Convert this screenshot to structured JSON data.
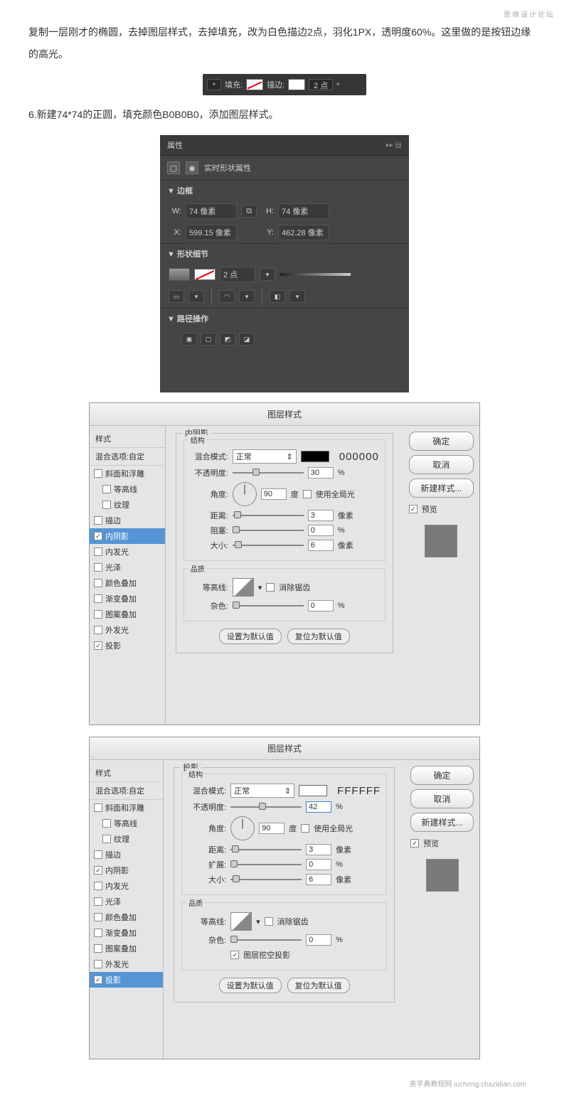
{
  "watermark": "思缘设计论坛",
  "paragraphs": {
    "p1": "复制一层刚才的椭圆，去掉图层样式，去掉填充，改为白色描边2点，羽化1PX，透明度60%。这里做的是按钮边缘的高光。",
    "p2": "6.新建74*74的正圆，填充颜色B0B0B0，添加图层样式。"
  },
  "toolbar": {
    "fill_label": "填充:",
    "stroke_label": "描边:",
    "stroke_value": "2 点"
  },
  "properties": {
    "title": "属性",
    "subtitle": "实时形状属性",
    "section_bounds": "▼ 边框",
    "w_label": "W:",
    "w_value": "74 像素",
    "h_label": "H:",
    "h_value": "74 像素",
    "x_label": "X:",
    "x_value": "599.15 像素",
    "y_label": "Y:",
    "y_value": "462.28 像素",
    "section_shape": "▼ 形状细节",
    "stroke_value": "2 点",
    "section_path": "▼ 路径操作"
  },
  "layer_style1": {
    "title": "图层样式",
    "styles_header": "样式",
    "blend_options": "混合选项:自定",
    "items": {
      "bevel": "斜面和浮雕",
      "contour_s": "等高线",
      "texture": "纹理",
      "stroke": "描边",
      "inner_shadow": "内阴影",
      "inner_glow": "内发光",
      "satin": "光泽",
      "color_overlay": "颜色叠加",
      "gradient_overlay": "渐变叠加",
      "pattern_overlay": "图案叠加",
      "outer_glow": "外发光",
      "drop_shadow": "投影"
    },
    "main": {
      "group_title": "内阴影",
      "structure": "结构",
      "blend_mode_label": "混合模式:",
      "blend_mode_value": "正常",
      "color_code": "000000",
      "opacity_label": "不透明度:",
      "opacity_value": "30",
      "opacity_unit": "%",
      "angle_label": "角度:",
      "angle_value": "90",
      "angle_unit": "度",
      "global_light": "使用全局光",
      "distance_label": "距离:",
      "distance_value": "3",
      "distance_unit": "像素",
      "choke_label": "阻塞:",
      "choke_value": "0",
      "choke_unit": "%",
      "size_label": "大小:",
      "size_value": "6",
      "size_unit": "像素",
      "quality": "品质",
      "contour_label": "等高线:",
      "anti_alias": "消除锯齿",
      "noise_label": "杂色:",
      "noise_value": "0",
      "noise_unit": "%",
      "set_default": "设置为默认值",
      "reset_default": "复位为默认值"
    },
    "buttons": {
      "ok": "确定",
      "cancel": "取消",
      "new_style": "新建样式...",
      "preview": "预览"
    }
  },
  "layer_style2": {
    "title": "图层样式",
    "main": {
      "group_title": "投影",
      "structure": "结构",
      "blend_mode_label": "混合模式:",
      "blend_mode_value": "正常",
      "color_code": "FFFFFF",
      "opacity_label": "不透明度:",
      "opacity_value": "42",
      "opacity_unit": "%",
      "angle_label": "角度:",
      "angle_value": "90",
      "angle_unit": "度",
      "global_light": "使用全局光",
      "distance_label": "距离:",
      "distance_value": "3",
      "distance_unit": "像素",
      "spread_label": "扩展:",
      "spread_value": "0",
      "spread_unit": "%",
      "size_label": "大小:",
      "size_value": "6",
      "size_unit": "像素",
      "quality": "品质",
      "contour_label": "等高线:",
      "anti_alias": "消除锯齿",
      "noise_label": "杂色:",
      "noise_value": "0",
      "noise_unit": "%",
      "knockout": "图层挖空投影",
      "set_default": "设置为默认值",
      "reset_default": "复位为默认值"
    }
  },
  "footer": "查字典教程网\niucheng.chazidian.com"
}
